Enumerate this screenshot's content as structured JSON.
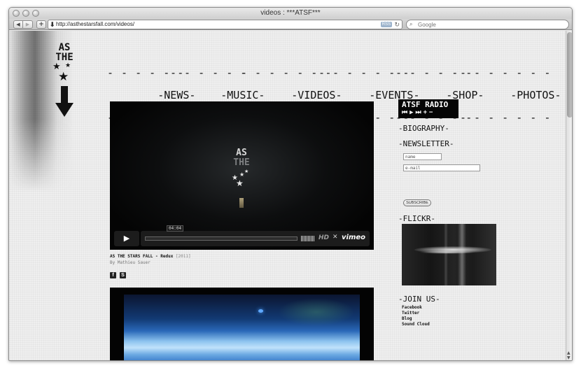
{
  "window": {
    "title": "videos : ***ATSF***"
  },
  "toolbar": {
    "back_icon": "back-arrow-icon",
    "forward_icon": "forward-arrow-icon",
    "add_icon": "plus-icon",
    "url": "http://asthestarsfall.com/videos/",
    "rss_label": "RSS",
    "search_placeholder": "Google"
  },
  "logo": {
    "line1": "AS",
    "line2": "THE"
  },
  "nav": {
    "items": [
      {
        "label": "-NEWS-"
      },
      {
        "label": "-MUSIC-"
      },
      {
        "label": "-VIDEOS-"
      },
      {
        "label": "-EVENTS-"
      },
      {
        "label": "-SHOP-"
      },
      {
        "label": "-PHOTOS-"
      }
    ]
  },
  "video1": {
    "overlay_line1": "AS",
    "overlay_line2": "THE",
    "duration": "04:04",
    "hd_label": "HD",
    "brand": "vimeo",
    "title": "AS THE STARS FALL - Redux",
    "year": "[2011]",
    "byline": "By Mathieu Sauer"
  },
  "share": {
    "facebook_icon": "facebook-icon",
    "facebook_glyph": "f",
    "second_icon": "share-icon",
    "second_glyph": "S"
  },
  "sidebar": {
    "radio": {
      "title": "ATSF RADIO",
      "controls": "⏮▶⏭+−"
    },
    "biography": "-BIOGRAPHY-",
    "newsletter": {
      "heading": "-NEWSLETTER-",
      "name_placeholder": "name",
      "email_placeholder": "e-mail",
      "subscribe_label": "SUBSCRIBE"
    },
    "flickr_heading": "-FLICKR-",
    "join": {
      "heading": "-JOIN US-",
      "links": [
        "Facebook",
        "Twitter",
        "Blog",
        "Sound Cloud"
      ]
    }
  }
}
